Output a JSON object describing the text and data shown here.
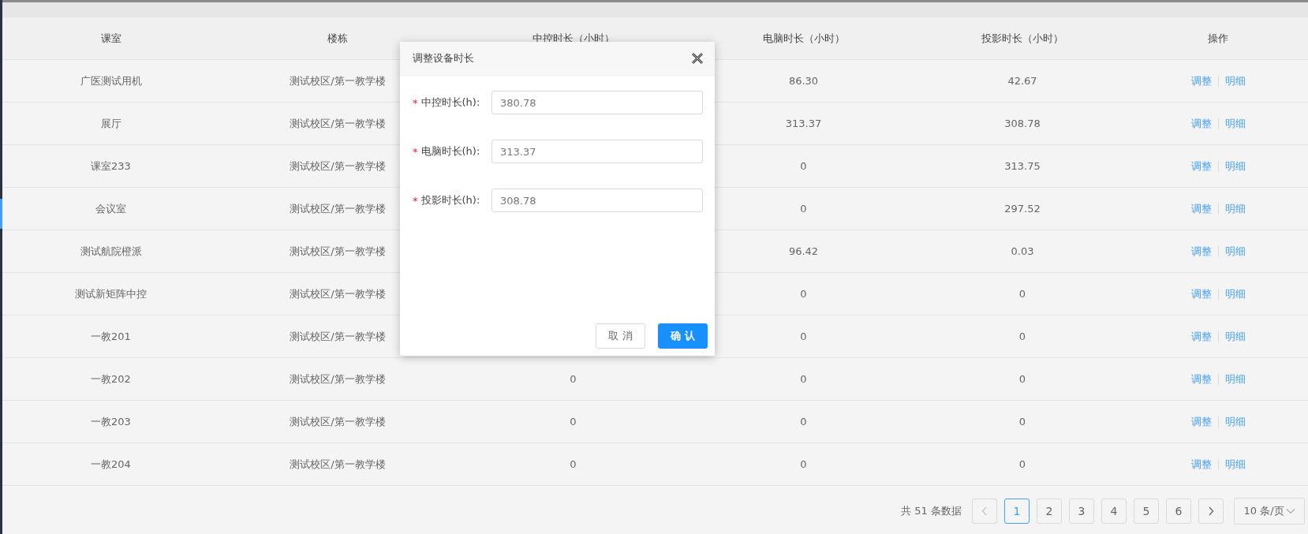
{
  "table": {
    "columns": [
      "课室",
      "楼栋",
      "中控时长（小时）",
      "电脑时长（小时）",
      "投影时长（小时）",
      "操作"
    ],
    "rows": [
      {
        "room": "广医测试用机",
        "building": "测试校区/第一教学楼",
        "pc": "86.30",
        "projector": "42.67",
        "actions": [
          "调整",
          "明细"
        ]
      },
      {
        "room": "展厅",
        "building": "测试校区/第一教学楼",
        "pc": "313.37",
        "projector": "308.78",
        "actions": [
          "调整",
          "明细"
        ]
      },
      {
        "room": "课室233",
        "building": "测试校区/第一教学楼",
        "pc": "0",
        "projector": "313.75",
        "actions": [
          "调整",
          "明细"
        ]
      },
      {
        "room": "会议室",
        "building": "测试校区/第一教学楼",
        "pc": "0",
        "projector": "297.52",
        "actions": [
          "调整",
          "明细"
        ]
      },
      {
        "room": "测试航院橙派",
        "building": "测试校区/第一教学楼",
        "pc": "96.42",
        "projector": "0.03",
        "actions": [
          "调整",
          "明细"
        ]
      },
      {
        "room": "测试新矩阵中控",
        "building": "测试校区/第一教学楼",
        "pc": "0",
        "projector": "0",
        "actions": [
          "调整",
          "明细"
        ]
      },
      {
        "room": "一教201",
        "building": "测试校区/第一教学楼",
        "pc": "0",
        "projector": "0",
        "actions": [
          "调整",
          "明细"
        ]
      },
      {
        "room": "一教202",
        "building": "测试校区/第一教学楼",
        "control": "0",
        "pc": "0",
        "projector": "0",
        "actions": [
          "调整",
          "明细"
        ]
      },
      {
        "room": "一教203",
        "building": "测试校区/第一教学楼",
        "control": "0",
        "pc": "0",
        "projector": "0",
        "actions": [
          "调整",
          "明细"
        ]
      },
      {
        "room": "一教204",
        "building": "测试校区/第一教学楼",
        "control": "0",
        "pc": "0",
        "projector": "0",
        "actions": [
          "调整",
          "明细"
        ]
      }
    ]
  },
  "pagination": {
    "total": "共 51 条数据",
    "pages": [
      {
        "label": "1",
        "selected": true
      },
      {
        "label": "2",
        "selected": false
      },
      {
        "label": "3",
        "selected": false
      },
      {
        "label": "4",
        "selected": false
      },
      {
        "label": "5",
        "selected": false
      },
      {
        "label": "6",
        "selected": false
      }
    ],
    "page_size": "10 条/页"
  },
  "dialog": {
    "title": "调整设备时长",
    "fields": [
      {
        "label": "中控时长(h):",
        "required_mark": "*",
        "value": "380.78"
      },
      {
        "label": "电脑时长(h):",
        "required_mark": "*",
        "value": "313.37"
      },
      {
        "label": "投影时长(h):",
        "required_mark": "*",
        "value": "308.78"
      }
    ],
    "buttons": [
      {
        "label": "取 消",
        "kind": "default"
      },
      {
        "label": "确 认",
        "kind": "primary"
      }
    ]
  }
}
